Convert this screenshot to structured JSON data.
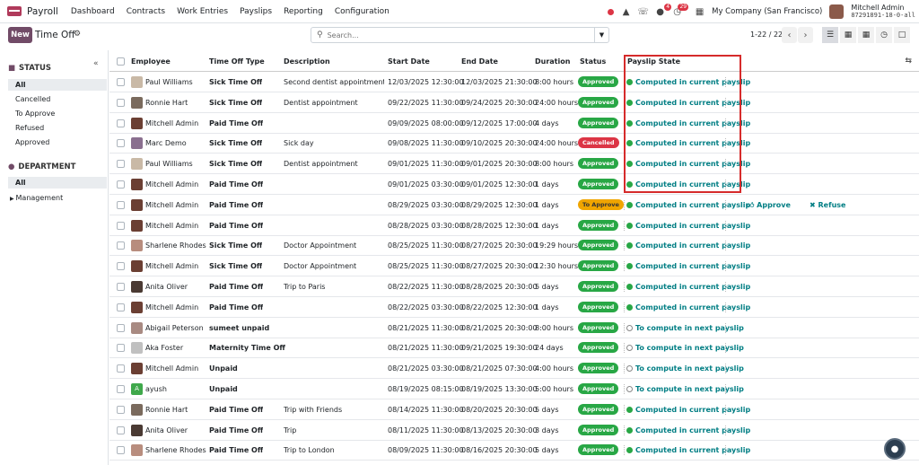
{
  "topbar": {
    "app_name": "Payroll",
    "menus": [
      "Dashboard",
      "Contracts",
      "Work Entries",
      "Payslips",
      "Reporting",
      "Configuration"
    ],
    "badges": {
      "chat": "4",
      "activity": "29"
    },
    "company": "My Company (San Francisco)",
    "user": "Mitchell Admin",
    "db": "87291891-18-0-all"
  },
  "control": {
    "new_label": "New",
    "breadcrumb": "Time Off",
    "search_placeholder": "Search...",
    "pager": "1-22 / 22"
  },
  "sidebar": {
    "status_title": "STATUS",
    "status_items": [
      "All",
      "Cancelled",
      "To Approve",
      "Refused",
      "Approved"
    ],
    "department_title": "DEPARTMENT",
    "department_items": [
      "All",
      "Management"
    ]
  },
  "table": {
    "columns": [
      "Employee",
      "Time Off Type",
      "Description",
      "Start Date",
      "End Date",
      "Duration",
      "Status",
      "Payslip State"
    ],
    "actions": {
      "approve": "Approve",
      "refuse": "Refuse"
    },
    "rows": [
      {
        "employee": "Paul Williams",
        "type": "Sick Time Off",
        "desc": "Second dentist appointment",
        "start": "12/03/2025 12:30:00",
        "end": "12/03/2025 21:30:00",
        "duration": "8:00 hours",
        "status": "Approved",
        "payslip": "Computed in current payslip",
        "av": "#c9b9a6"
      },
      {
        "employee": "Ronnie Hart",
        "type": "Sick Time Off",
        "desc": "Dentist appointment",
        "start": "09/22/2025 11:30:00",
        "end": "09/24/2025 20:30:00",
        "duration": "24:00 hours",
        "status": "Approved",
        "payslip": "Computed in current payslip",
        "av": "#7a6a5d"
      },
      {
        "employee": "Mitchell Admin",
        "type": "Paid Time Off",
        "desc": "",
        "start": "09/09/2025 08:00:00",
        "end": "09/12/2025 17:00:00",
        "duration": "4 days",
        "status": "Approved",
        "payslip": "Computed in current payslip",
        "av": "#6b3f33"
      },
      {
        "employee": "Marc Demo",
        "type": "Sick Time Off",
        "desc": "Sick day",
        "start": "09/08/2025 11:30:00",
        "end": "09/10/2025 20:30:00",
        "duration": "24:00 hours",
        "status": "Cancelled",
        "payslip": "Computed in current payslip",
        "av": "#8a6f8f"
      },
      {
        "employee": "Paul Williams",
        "type": "Sick Time Off",
        "desc": "Dentist appointment",
        "start": "09/01/2025 11:30:00",
        "end": "09/01/2025 20:30:00",
        "duration": "8:00 hours",
        "status": "Approved",
        "payslip": "Computed in current payslip",
        "av": "#c9b9a6"
      },
      {
        "employee": "Mitchell Admin",
        "type": "Paid Time Off",
        "desc": "",
        "start": "09/01/2025 03:30:00",
        "end": "09/01/2025 12:30:00",
        "duration": "1 days",
        "status": "Approved",
        "payslip": "Computed in current payslip",
        "av": "#6b3f33"
      },
      {
        "employee": "Mitchell Admin",
        "type": "Paid Time Off",
        "desc": "",
        "start": "08/29/2025 03:30:00",
        "end": "08/29/2025 12:30:00",
        "duration": "1 days",
        "status": "To Approve",
        "payslip": "Computed in current payslip",
        "av": "#6b3f33",
        "actions": true
      },
      {
        "employee": "Mitchell Admin",
        "type": "Paid Time Off",
        "desc": "",
        "start": "08/28/2025 03:30:00",
        "end": "08/28/2025 12:30:00",
        "duration": "1 days",
        "status": "Approved",
        "payslip": "Computed in current payslip",
        "av": "#6b3f33"
      },
      {
        "employee": "Sharlene Rhodes",
        "type": "Sick Time Off",
        "desc": "Doctor Appointment",
        "start": "08/25/2025 11:30:00",
        "end": "08/27/2025 20:30:00",
        "duration": "19:29 hours",
        "status": "Approved",
        "payslip": "Computed in current payslip",
        "av": "#b88d7e"
      },
      {
        "employee": "Mitchell Admin",
        "type": "Sick Time Off",
        "desc": "Doctor Appointment",
        "start": "08/25/2025 11:30:00",
        "end": "08/27/2025 20:30:00",
        "duration": "12:30 hours",
        "status": "Approved",
        "payslip": "Computed in current payslip",
        "av": "#6b3f33"
      },
      {
        "employee": "Anita Oliver",
        "type": "Paid Time Off",
        "desc": "Trip to Paris",
        "start": "08/22/2025 11:30:00",
        "end": "08/28/2025 20:30:00",
        "duration": "5 days",
        "status": "Approved",
        "payslip": "Computed in current payslip",
        "av": "#4a3a33"
      },
      {
        "employee": "Mitchell Admin",
        "type": "Paid Time Off",
        "desc": "",
        "start": "08/22/2025 03:30:00",
        "end": "08/22/2025 12:30:00",
        "duration": "1 days",
        "status": "Approved",
        "payslip": "Computed in current payslip",
        "av": "#6b3f33"
      },
      {
        "employee": "Abigail Peterson",
        "type": "sumeet unpaid",
        "desc": "",
        "start": "08/21/2025 11:30:00",
        "end": "08/21/2025 20:30:00",
        "duration": "8:00 hours",
        "status": "Approved",
        "payslip": "To compute in next payslip",
        "av": "#a88a82"
      },
      {
        "employee": "Aka Foster",
        "type": "Maternity Time Off",
        "desc": "",
        "start": "08/21/2025 11:30:00",
        "end": "09/21/2025 19:30:00",
        "duration": "24 days",
        "status": "Approved",
        "payslip": "To compute in next payslip",
        "av": "#c0c0c0"
      },
      {
        "employee": "Mitchell Admin",
        "type": "Unpaid",
        "desc": "",
        "start": "08/21/2025 03:30:00",
        "end": "08/21/2025 07:30:00",
        "duration": "4:00 hours",
        "status": "Approved",
        "payslip": "To compute in next payslip",
        "av": "#6b3f33"
      },
      {
        "employee": "ayush",
        "type": "Unpaid",
        "desc": "",
        "start": "08/19/2025 08:15:00",
        "end": "08/19/2025 13:30:00",
        "duration": "5:00 hours",
        "status": "Approved",
        "payslip": "To compute in next payslip",
        "av": "#3fa84b",
        "letter": "A"
      },
      {
        "employee": "Ronnie Hart",
        "type": "Paid Time Off",
        "desc": "Trip with Friends",
        "start": "08/14/2025 11:30:00",
        "end": "08/20/2025 20:30:00",
        "duration": "5 days",
        "status": "Approved",
        "payslip": "Computed in current payslip",
        "av": "#7a6a5d"
      },
      {
        "employee": "Anita Oliver",
        "type": "Paid Time Off",
        "desc": "Trip",
        "start": "08/11/2025 11:30:00",
        "end": "08/13/2025 20:30:00",
        "duration": "3 days",
        "status": "Approved",
        "payslip": "Computed in current payslip",
        "av": "#4a3a33"
      },
      {
        "employee": "Sharlene Rhodes",
        "type": "Paid Time Off",
        "desc": "Trip to London",
        "start": "08/09/2025 11:30:00",
        "end": "08/16/2025 20:30:00",
        "duration": "5 days",
        "status": "Approved",
        "payslip": "Computed in current payslip",
        "av": "#b88d7e"
      }
    ]
  },
  "colors": {
    "brand": "#714b67",
    "approved": "#28a745",
    "cancelled": "#dc3545",
    "to_approve": "#f0a500",
    "link": "#017e84",
    "highlight": "#d62b2b"
  }
}
